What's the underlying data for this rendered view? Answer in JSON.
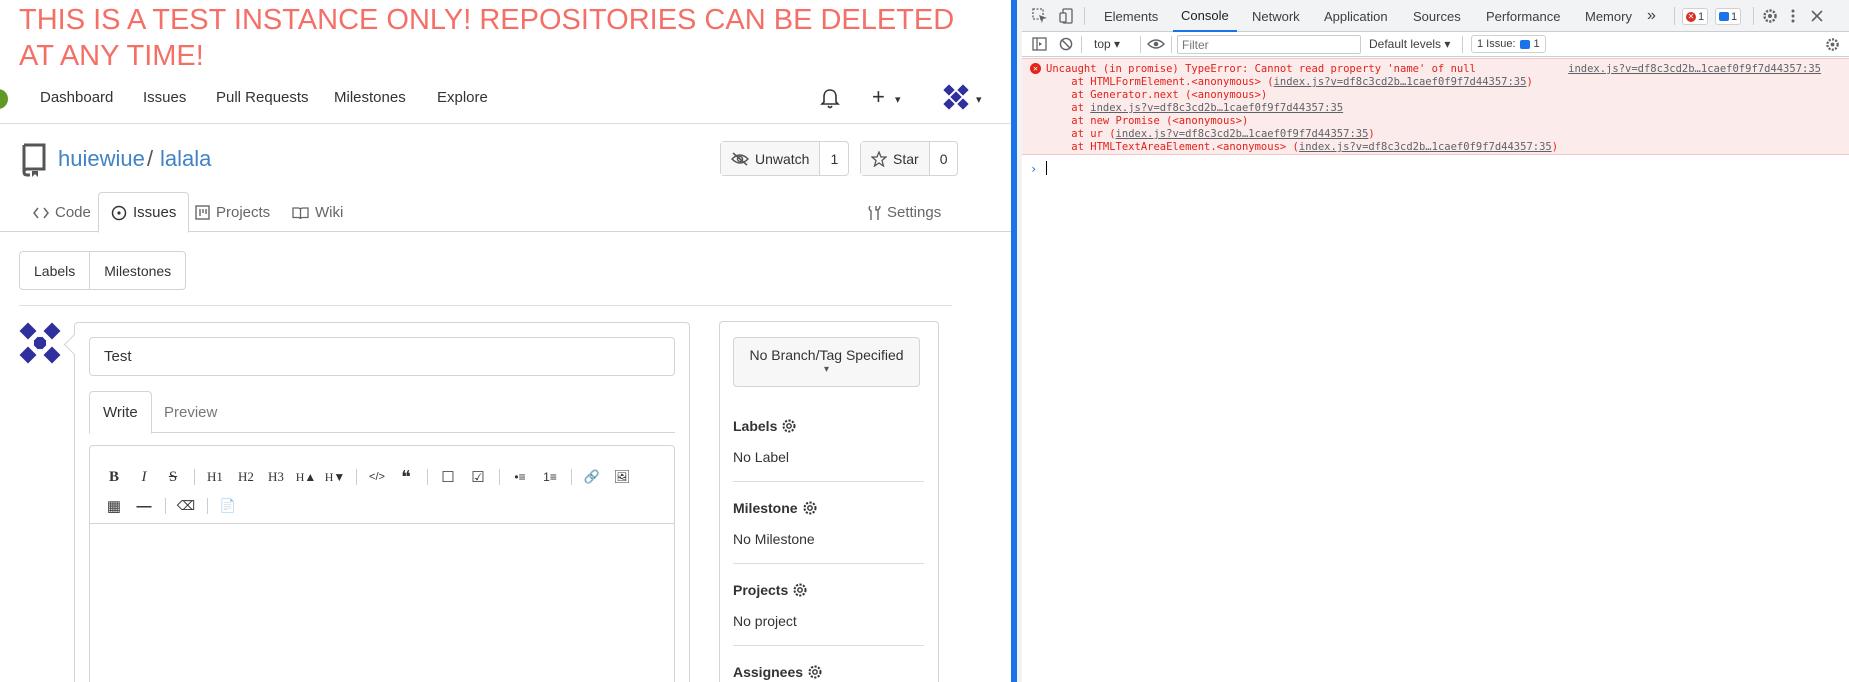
{
  "banner": "THIS IS A TEST INSTANCE ONLY! REPOSITORIES CAN BE DELETED AT ANY TIME!",
  "nav": {
    "items": [
      "Dashboard",
      "Issues",
      "Pull Requests",
      "Milestones",
      "Explore"
    ],
    "plus_symbol": "+",
    "caret": "▾"
  },
  "repo": {
    "owner": "huiewiue",
    "separator": "/",
    "name": "lalala",
    "unwatch_label": "Unwatch",
    "watch_count": "1",
    "star_label": "Star",
    "star_count": "0"
  },
  "repo_tabs": {
    "code": "Code",
    "issues": "Issues",
    "projects": "Projects",
    "wiki": "Wiki",
    "settings": "Settings"
  },
  "subnav": {
    "labels": "Labels",
    "milestones": "Milestones"
  },
  "issue_form": {
    "title_value": "Test",
    "write_tab": "Write",
    "preview_tab": "Preview",
    "toolbar_row1": [
      "B",
      "I",
      "S",
      "H1",
      "H2",
      "H3",
      "H▲",
      "H▼",
      "</>",
      "❝",
      "☐",
      "☑",
      "•≡",
      "1≡",
      "🔗",
      "🖼"
    ],
    "toolbar_row2": [
      "▦",
      "—",
      "⌫",
      "📄"
    ]
  },
  "sidebar": {
    "branch_button": "No Branch/Tag Specified",
    "branch_caret": "▾",
    "labels_title": "Labels",
    "labels_value": "No Label",
    "milestone_title": "Milestone",
    "milestone_value": "No Milestone",
    "projects_title": "Projects",
    "projects_value": "No project",
    "assignees_title": "Assignees"
  },
  "devtools": {
    "tabs": [
      "Elements",
      "Console",
      "Network",
      "Application",
      "Sources",
      "Performance",
      "Memory"
    ],
    "more": "»",
    "error_badge": "1",
    "message_badge": "1",
    "context": "top ▾",
    "filter_placeholder": "Filter",
    "levels": "Default levels ▾",
    "issues_label": "1 Issue:",
    "issues_count": "1",
    "error": {
      "message": "Uncaught (in promise) TypeError: Cannot read property 'name' of null",
      "source": "index.js?v=df8c3cd2b…1caef0f9f7d44357:35",
      "stack": [
        {
          "prefix": "    at HTMLFormElement.<anonymous> (",
          "link": "index.js?v=df8c3cd2b…1caef0f9f7d44357:35",
          "suffix": ")"
        },
        {
          "prefix": "    at Generator.next (<anonymous>)",
          "link": "",
          "suffix": ""
        },
        {
          "prefix": "    at ",
          "link": "index.js?v=df8c3cd2b…1caef0f9f7d44357:35",
          "suffix": ""
        },
        {
          "prefix": "    at new Promise (<anonymous>)",
          "link": "",
          "suffix": ""
        },
        {
          "prefix": "    at ur (",
          "link": "index.js?v=df8c3cd2b…1caef0f9f7d44357:35",
          "suffix": ")"
        },
        {
          "prefix": "    at HTMLTextAreaElement.<anonymous> (",
          "link": "index.js?v=df8c3cd2b…1caef0f9f7d44357:35",
          "suffix": ")"
        }
      ]
    },
    "prompt": "›"
  },
  "colors": {
    "banner": "#f47067",
    "link": "#4183c4",
    "devtools_accent": "#1a73e8",
    "error_text": "#e2231a",
    "error_bg": "#fcebeb"
  }
}
